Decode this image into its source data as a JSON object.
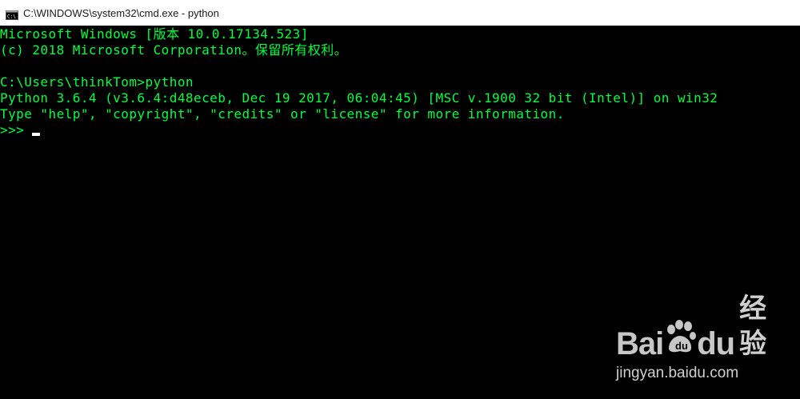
{
  "window": {
    "title": "C:\\WINDOWS\\system32\\cmd.exe - python",
    "icon": "cmd-icon"
  },
  "console": {
    "text_color": "#00ff40",
    "background": "#000000",
    "lines": [
      "Microsoft Windows [版本 10.0.17134.523]",
      "(c) 2018 Microsoft Corporation。保留所有权利。",
      "",
      "C:\\Users\\thinkTom>python",
      "Python 3.6.4 (v3.6.4:d48eceb, Dec 19 2017, 06:04:45) [MSC v.1900 32 bit (Intel)] on win32",
      "Type \"help\", \"copyright\", \"credits\" or \"license\" for more information.",
      ">>> "
    ]
  },
  "watermark": {
    "brand_left": "Bai",
    "brand_right": "du",
    "product": "经验",
    "url": "jingyan.baidu.com"
  }
}
